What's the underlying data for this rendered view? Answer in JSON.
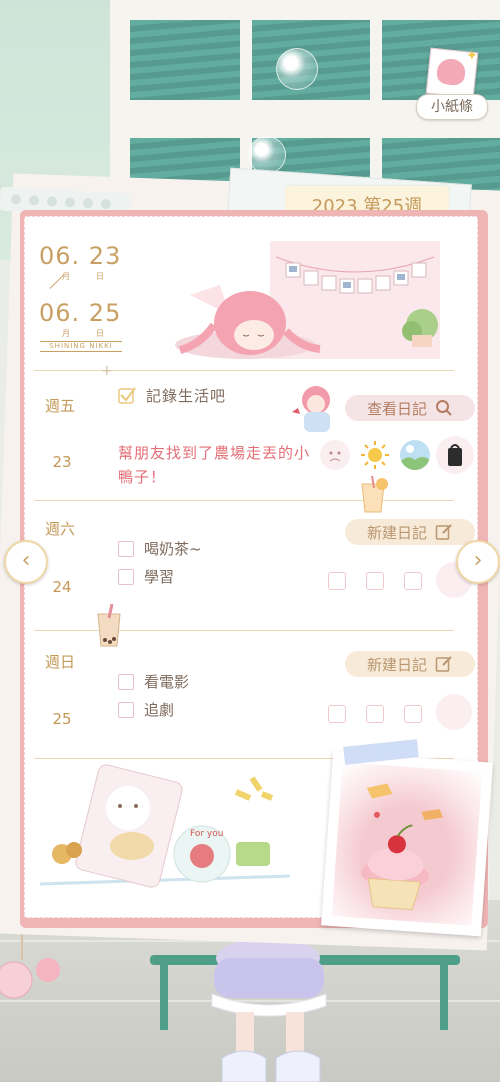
{
  "note_button": {
    "label": "小紙條"
  },
  "planner": {
    "week_title": "2023 第25週",
    "start_date": {
      "value": "06. 23",
      "month_label": "月",
      "day_label": "日"
    },
    "end_date": {
      "value": "06. 25",
      "month_label": "月",
      "day_label": "日"
    },
    "brand": "SHINING NIKKI",
    "days": [
      {
        "weekday": "週五",
        "day": "23",
        "prompt": "記錄生活吧",
        "entry": "幫朋友找到了農場走丟的小鴨子！",
        "action": "查看日記",
        "moods": [
          "sad-face-icon",
          "sun-icon",
          "landscape-icon",
          "bag-icon"
        ]
      },
      {
        "weekday": "週六",
        "day": "24",
        "todos": [
          "喝奶茶~",
          "學習"
        ],
        "action": "新建日記"
      },
      {
        "weekday": "週日",
        "day": "25",
        "todos": [
          "看電影",
          "追劇"
        ],
        "action": "新建日記"
      }
    ],
    "sticker_text": "For you"
  },
  "colors": {
    "accent_gold": "#c9a064",
    "card_pink": "#efb5b5",
    "entry_red": "#e36f77"
  }
}
